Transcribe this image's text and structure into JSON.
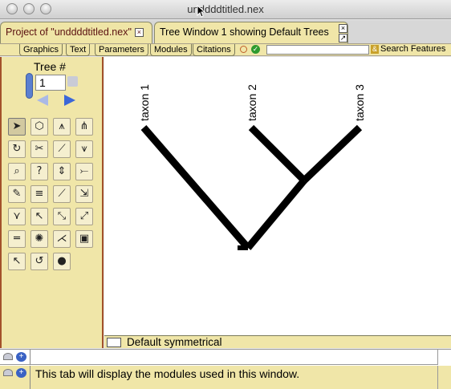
{
  "window": {
    "title": "unddddtitled.nex"
  },
  "tabs": [
    {
      "label": "Project of \"unddddtitled.nex\"",
      "active": false
    },
    {
      "label": "Tree Window 1 showing Default Trees",
      "active": true
    }
  ],
  "toolbar": {
    "tabs": [
      "Graphics",
      "Text",
      "Parameters",
      "Modules",
      "Citations"
    ],
    "search_label": "Search Features",
    "search_value": ""
  },
  "tree_panel": {
    "label": "Tree #",
    "value": "1"
  },
  "tools": [
    "arrow-tool-icon",
    "cube-tool-icon",
    "split-tool-icon",
    "fan-tool-icon",
    "reroot-tool-icon",
    "scissors-tool-icon",
    "ladderize-tool-icon",
    "collapse-tool-icon",
    "magnifier-tool-icon",
    "help-tool-icon",
    "stretch-tool-icon",
    "prune-tool-icon",
    "paint-tool-icon",
    "name-tool-icon",
    "branch-tool-icon",
    "select-branch-tool-icon",
    "lineage-tool-icon",
    "pointer-tool-icon",
    "move-branch-tool-icon",
    "nodes-tool-icon",
    "scale-tool-icon",
    "spin-tool-icon",
    "join-tool-icon",
    "clipboard-tool-icon",
    "info-tool-icon",
    "rotate-tool-icon",
    "color-tool-icon"
  ],
  "tree": {
    "taxa": [
      "taxon 1",
      "taxon 2",
      "taxon 3"
    ],
    "line_color": "#000000"
  },
  "status": {
    "label": "Default symmetrical"
  },
  "log": {
    "message": "This tab will display the modules used in this window."
  },
  "colors": {
    "panel": "#f0e6a8",
    "accent_border": "#a3522a",
    "stepper": "#5b7fd0"
  }
}
